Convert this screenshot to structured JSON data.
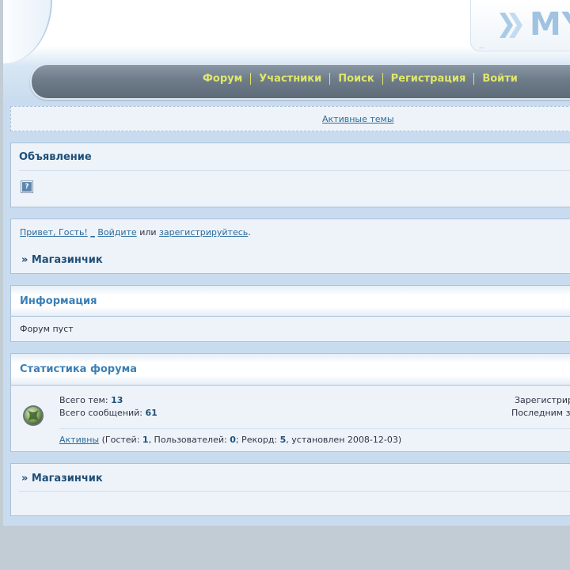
{
  "logo": {
    "text": "MY",
    "dots": "..."
  },
  "nav": {
    "items": [
      {
        "label": "Форум"
      },
      {
        "label": "Участники"
      },
      {
        "label": "Поиск"
      },
      {
        "label": "Регистрация"
      },
      {
        "label": "Войти"
      }
    ]
  },
  "active_topics": {
    "label": "Активные темы"
  },
  "announcement": {
    "title": "Объявление",
    "broken_image_glyph": "?"
  },
  "welcome": {
    "greeting": "Привет, Гость!",
    "underscore": "_",
    "login": "Войдите",
    "or": "или",
    "register": "зарегистрируйтесь",
    "period": "."
  },
  "breadcrumb": {
    "label": "» Магазинчик"
  },
  "info": {
    "title": "Информация",
    "text": "Форум пуст"
  },
  "stats": {
    "title": "Статистика форума",
    "topics_label": "Всего тем:",
    "topics_value": "13",
    "posts_label": "Всего сообщений:",
    "posts_value": "61",
    "registered_label": "Зарегистрир",
    "last_label": "Последним за",
    "active_link": "Активны",
    "guests_label": "(Гостей:",
    "guests_value": "1",
    "users_label": ", Пользователей:",
    "users_value": "0",
    "record_label": "; Рекорд:",
    "record_value": "5",
    "record_date": ", установлен 2008-12-03)"
  },
  "footer_breadcrumb": {
    "label": "» Магазинчик"
  },
  "colors": {
    "nav_text": "#dfe66a",
    "link": "#2b6b9c",
    "heading": "#1e4f78",
    "section_title": "#3a7fb6"
  },
  "icons": {
    "xbox": "xbox-icon",
    "logo_arrows": "double-chevron-icon",
    "broken_image": "broken-image-icon"
  }
}
